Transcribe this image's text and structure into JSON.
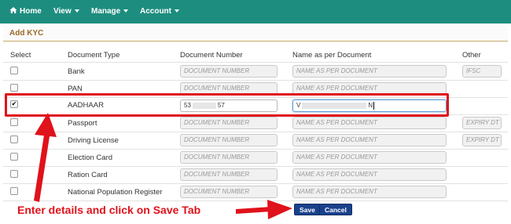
{
  "nav": {
    "home": "Home",
    "view": "View",
    "manage": "Manage",
    "account": "Account",
    "color": "#1d8d7f"
  },
  "panel": {
    "title": "Add KYC"
  },
  "columns": {
    "select": "Select",
    "document_type": "Document Type",
    "document_number": "Document Number",
    "name": "Name as per Document",
    "other": "Other"
  },
  "rows": [
    {
      "type": "Bank",
      "checked": false,
      "number_placeholder": "DOCUMENT NUMBER",
      "name_placeholder": "NAME AS PER DOCUMENT",
      "other_placeholder": "IFSC"
    },
    {
      "type": "PAN",
      "checked": false,
      "number_placeholder": "DOCUMENT NUMBER",
      "name_placeholder": "NAME AS PER DOCUMENT"
    },
    {
      "type": "AADHAAR",
      "checked": true,
      "number_value_start": "53",
      "number_value_end": "57",
      "name_value_start": "V",
      "name_value_end": "N"
    },
    {
      "type": "Passport",
      "checked": false,
      "number_placeholder": "DOCUMENT NUMBER",
      "name_placeholder": "NAME AS PER DOCUMENT",
      "other_placeholder": "EXPIRY DT"
    },
    {
      "type": "Driving License",
      "checked": false,
      "number_placeholder": "DOCUMENT NUMBER",
      "name_placeholder": "NAME AS PER DOCUMENT",
      "other_placeholder": "EXPIRY DT"
    },
    {
      "type": "Election Card",
      "checked": false,
      "number_placeholder": "DOCUMENT NUMBER",
      "name_placeholder": "NAME AS PER DOCUMENT"
    },
    {
      "type": "Ration Card",
      "checked": false,
      "number_placeholder": "DOCUMENT NUMBER",
      "name_placeholder": "NAME AS PER DOCUMENT"
    },
    {
      "type": "National Population Register",
      "checked": false,
      "number_placeholder": "DOCUMENT NUMBER",
      "name_placeholder": "NAME AS PER DOCUMENT"
    }
  ],
  "buttons": {
    "save": "Save",
    "cancel": "Cancel",
    "color": "#19418b"
  },
  "annotation": {
    "text": "Enter details and click on Save Tab",
    "color": "#e0121b"
  }
}
